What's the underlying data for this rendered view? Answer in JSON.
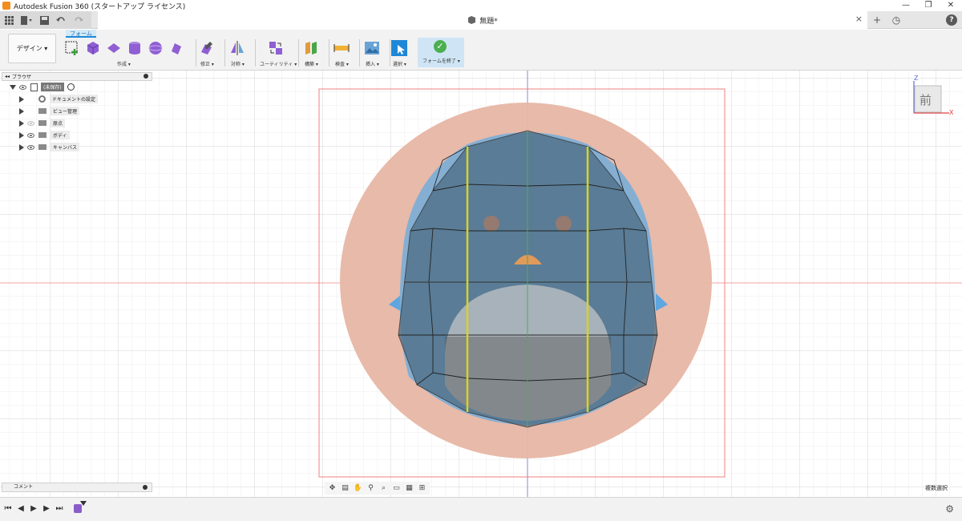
{
  "window": {
    "title": "Autodesk Fusion 360 (スタートアップ ライセンス)",
    "minimize": "—",
    "restore": "❐",
    "close": "✕"
  },
  "document_tab": {
    "title": "無題*",
    "close": "×"
  },
  "quick_access": {
    "grid_icon": "apps-grid-icon",
    "file_icon": "file-icon",
    "save_icon": "save-icon",
    "undo_icon": "undo-icon",
    "redo_icon": "redo-icon"
  },
  "right_icons": {
    "new_tab": "+",
    "history": "◷",
    "help": "?"
  },
  "ribbon": {
    "workspace": "デザイン ▾",
    "active_tab": "フォーム",
    "groups": {
      "create": "作成 ▾",
      "modify": "修正 ▾",
      "symmetry": "対称 ▾",
      "utility": "ユーティリティ ▾",
      "construct": "構築 ▾",
      "inspect": "検査 ▾",
      "insert": "挿入 ▾",
      "select": "選択 ▾",
      "finish": "フォームを終了 ▾"
    }
  },
  "browser": {
    "header": "ブラウザ",
    "collapse": "◂◂",
    "root": "(未保存)",
    "items": [
      {
        "label": "ドキュメントの設定"
      },
      {
        "label": "ビュー管理"
      },
      {
        "label": "原点"
      },
      {
        "label": "ボディ"
      },
      {
        "label": "キャンバス"
      }
    ]
  },
  "comments": {
    "label": "コメント"
  },
  "viewcube": {
    "face": "前",
    "axis_z": "Z",
    "axis_x": "X"
  },
  "status": {
    "selection_mode": "複数選択"
  },
  "colors": {
    "accent": "#1e88d8",
    "canvas_image": "#e7b3a2",
    "tsplines_body": "#6d9bc0",
    "symmetry_line": "#d8d322",
    "axis_red": "#f08080",
    "axis_green": "#4caf50",
    "axis_blue": "#5a6fd8"
  }
}
